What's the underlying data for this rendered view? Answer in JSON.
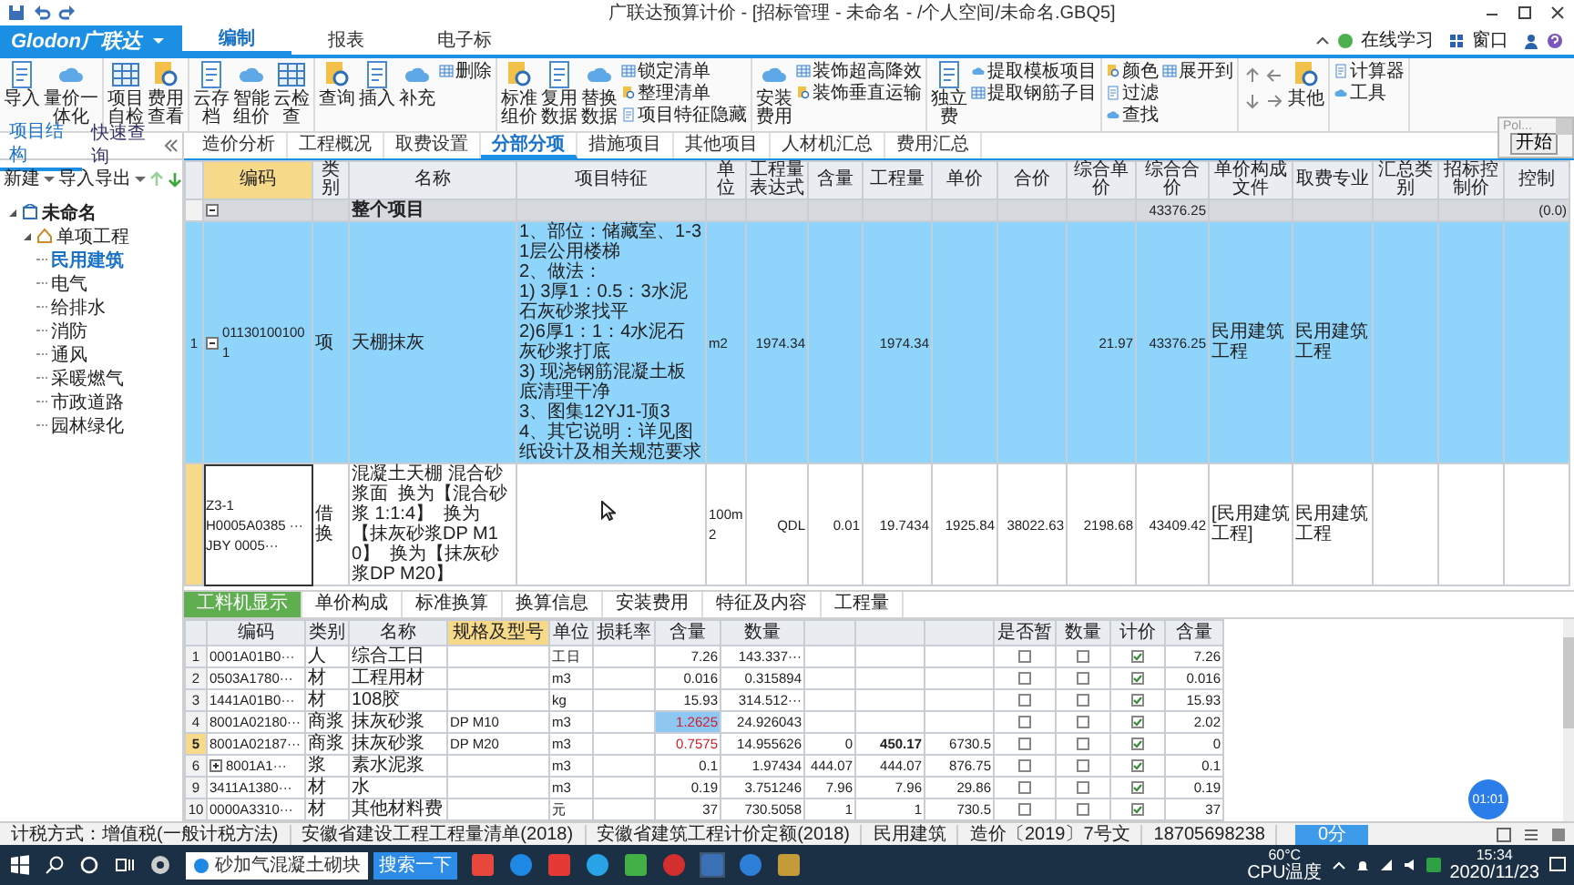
{
  "window": {
    "title": "广联达预算计价 - [招标管理 - 未命名 - /个人空间/未命名.GBQ5]"
  },
  "menu": {
    "logo": "Glodon广联达",
    "tabs": [
      {
        "label": "编制",
        "selected": true
      },
      {
        "label": "报表",
        "selected": false
      },
      {
        "label": "电子标",
        "selected": false
      }
    ],
    "right": [
      "在线学习",
      "窗口"
    ]
  },
  "ribbon": [
    {
      "items": [
        {
          "kind": "large",
          "label": "导入"
        },
        {
          "kind": "large",
          "label": "量价一体化"
        }
      ]
    },
    {
      "items": [
        {
          "kind": "large",
          "label": "项目自检"
        },
        {
          "kind": "large",
          "label": "费用查看"
        }
      ]
    },
    {
      "items": [
        {
          "kind": "large",
          "label": "云存档"
        },
        {
          "kind": "large",
          "label": "智能组价"
        },
        {
          "kind": "large",
          "label": "云检查"
        }
      ]
    },
    {
      "items": [
        {
          "kind": "large",
          "label": "查询"
        },
        {
          "kind": "large",
          "label": "插入"
        },
        {
          "kind": "large",
          "label": "补充"
        },
        {
          "kind": "small",
          "label": "删除"
        }
      ]
    },
    {
      "items": [
        {
          "kind": "large",
          "label": "标准组价"
        },
        {
          "kind": "large",
          "label": "复用数据"
        },
        {
          "kind": "large",
          "label": "替换数据"
        },
        {
          "kind": "small",
          "label": "锁定清单"
        },
        {
          "kind": "small",
          "label": "整理清单"
        },
        {
          "kind": "small",
          "label": "项目特征隐藏"
        }
      ]
    },
    {
      "items": [
        {
          "kind": "large",
          "label": "安装费用"
        },
        {
          "kind": "small",
          "label": "装饰超高降效"
        },
        {
          "kind": "small",
          "label": "装饰垂直运输"
        }
      ]
    },
    {
      "items": [
        {
          "kind": "large",
          "label": "独立费"
        },
        {
          "kind": "small",
          "label": "提取模板项目"
        },
        {
          "kind": "small",
          "label": "提取钢筋子目"
        }
      ]
    },
    {
      "items": [
        {
          "kind": "small",
          "label": "颜色"
        },
        {
          "kind": "small",
          "label": "过滤"
        },
        {
          "kind": "small",
          "label": "查找"
        },
        {
          "kind": "small",
          "label": "展开到"
        }
      ]
    },
    {
      "items": [
        {
          "kind": "arrows"
        },
        {
          "kind": "large",
          "label": "其他"
        }
      ]
    },
    {
      "items": [
        {
          "kind": "small",
          "label": "计算器"
        },
        {
          "kind": "small",
          "label": "工具"
        }
      ]
    }
  ],
  "left_panel": {
    "tabs": [
      {
        "label": "项目结构",
        "selected": true
      },
      {
        "label": "快速查询",
        "selected": false
      }
    ],
    "actions": [
      "新建",
      "导入导出"
    ],
    "tree": [
      {
        "label": "未命名",
        "expanded": true,
        "selected": false,
        "children": [
          {
            "label": "单项工程",
            "expanded": true,
            "selected": false,
            "children": [
              {
                "label": "民用建筑",
                "selected": true
              },
              {
                "label": "电气",
                "selected": false
              },
              {
                "label": "给排水",
                "selected": false
              },
              {
                "label": "消防",
                "selected": false
              },
              {
                "label": "通风",
                "selected": false
              },
              {
                "label": "采暖燃气",
                "selected": false
              },
              {
                "label": "市政道路",
                "selected": false
              },
              {
                "label": "园林绿化",
                "selected": false
              }
            ]
          }
        ]
      }
    ]
  },
  "tabs": [
    {
      "label": "造价分析",
      "selected": false
    },
    {
      "label": "工程概况",
      "selected": false
    },
    {
      "label": "取费设置",
      "selected": false
    },
    {
      "label": "分部分项",
      "selected": true
    },
    {
      "label": "措施项目",
      "selected": false
    },
    {
      "label": "其他项目",
      "selected": false
    },
    {
      "label": "人材机汇总",
      "selected": false
    },
    {
      "label": "费用汇总",
      "selected": false
    }
  ],
  "table": {
    "columns": [
      {
        "label": "编码",
        "current": true
      },
      {
        "label": "类别",
        "current": false
      },
      {
        "label": "名称",
        "current": false
      },
      {
        "label": "项目特征",
        "current": false
      },
      {
        "label": "单位",
        "current": false
      },
      {
        "label": "工程量表达式",
        "current": false
      },
      {
        "label": "含量",
        "current": false
      },
      {
        "label": "工程量",
        "current": false
      },
      {
        "label": "单价",
        "current": false
      },
      {
        "label": "合价",
        "current": false
      },
      {
        "label": "综合单价",
        "current": false
      },
      {
        "label": "综合合价",
        "current": false
      },
      {
        "label": "单价构成文件",
        "current": false
      },
      {
        "label": "取费专业",
        "current": false
      },
      {
        "label": "汇总类别",
        "current": false
      },
      {
        "label": "招标控制价",
        "current": false
      },
      {
        "label": "控制",
        "current": false
      }
    ],
    "rows": [
      {
        "kind": "section",
        "selected": false,
        "current": false,
        "expanded": true,
        "cells": [
          null,
          null,
          "整个项目",
          null,
          null,
          null,
          null,
          null,
          null,
          null,
          null,
          "43376.25",
          null,
          null,
          null,
          null,
          "(0.0)"
        ]
      },
      {
        "kind": "item",
        "no": "1",
        "selected": true,
        "current": false,
        "expanded": true,
        "cells": [
          "011301001001",
          "项",
          "天棚抹灰",
          "1、部位：储藏室、1-31层公用楼梯\n2、做法：\n1) 3厚1：0.5：3水泥石灰砂浆找平\n2)6厚1：1：4水泥石灰砂浆打底\n3) 现浇钢筋混凝土板底清理干净\n3、图集12YJ1-顶3\n4、其它说明：详见图纸设计及相关规范要求",
          "m2",
          "1974.34",
          null,
          "1974.34",
          null,
          null,
          "21.97",
          "43376.25",
          "民用建筑工程",
          "民用建筑工程",
          null,
          null,
          null
        ]
      },
      {
        "kind": "sub",
        "selected": false,
        "current": true,
        "cells": [
          "Z3-1\nH0005A0385 ···\nJBY 0005···",
          "借换",
          "混凝土天棚 混合砂浆面  换为【混合砂浆 1:1:4】  换为【抹灰砂浆DP M10】  换为【抹灰砂浆DP M20】",
          null,
          "100m2",
          "QDL",
          "0.01",
          "19.7434",
          "1925.84",
          "38022.63",
          "2198.68",
          "43409.42",
          "[民用建筑工程]",
          "民用建筑工程",
          null,
          null,
          null
        ]
      }
    ]
  },
  "detail": {
    "tabs": [
      {
        "label": "工料机显示",
        "selected": true
      },
      {
        "label": "单价构成",
        "selected": false
      },
      {
        "label": "标准换算",
        "selected": false
      },
      {
        "label": "换算信息",
        "selected": false
      },
      {
        "label": "安装费用",
        "selected": false
      },
      {
        "label": "特征及内容",
        "selected": false
      },
      {
        "label": "工程量",
        "selected": false
      }
    ],
    "columns": [
      {
        "label": "编码",
        "current": false
      },
      {
        "label": "类别",
        "current": false
      },
      {
        "label": "名称",
        "current": false
      },
      {
        "label": "规格及型号",
        "current": true
      },
      {
        "label": "单位",
        "current": false
      },
      {
        "label": "损耗率",
        "current": false
      },
      {
        "label": "含量",
        "current": false
      },
      {
        "label": "数量",
        "current": false
      },
      {
        "current": false
      },
      {
        "current": false
      },
      {
        "current": false
      },
      {
        "label": "是否暂",
        "current": false
      },
      {
        "label": "数量",
        "current": false
      },
      {
        "label": "计价",
        "current": false
      },
      {
        "label": "含量",
        "current": false
      }
    ],
    "rows": [
      {
        "no": "1",
        "selected": false,
        "has_children": false,
        "cells": [
          "0001A01B0···",
          "人",
          "综合工日",
          null,
          "工日",
          null,
          "7.26",
          "143.337···",
          null,
          null,
          null
        ],
        "flags": [
          false,
          false,
          true
        ],
        "modified": false,
        "original": "7.26"
      },
      {
        "no": "2",
        "selected": false,
        "has_children": false,
        "cells": [
          "0503A1780···",
          "材",
          "工程用材",
          null,
          "m3",
          null,
          "0.016",
          "0.315894",
          null,
          null,
          null
        ],
        "flags": [
          false,
          false,
          true
        ],
        "modified": false,
        "original": "0.016"
      },
      {
        "no": "3",
        "selected": false,
        "has_children": false,
        "cells": [
          "1441A01B0···",
          "材",
          "108胶",
          null,
          "kg",
          null,
          "15.93",
          "314.512···",
          null,
          null,
          null
        ],
        "flags": [
          false,
          false,
          true
        ],
        "modified": false,
        "original": "15.93"
      },
      {
        "no": "4",
        "selected": false,
        "has_children": false,
        "cells": [
          "8001A02180···",
          "商浆",
          "抹灰砂浆",
          "DP M10",
          "m3",
          null,
          "1.2625",
          "24.926043",
          null,
          null,
          null
        ],
        "flags": [
          false,
          false,
          true
        ],
        "modified": true,
        "original": "2.02"
      },
      {
        "no": "5",
        "selected": true,
        "has_children": false,
        "cells": [
          "8001A02187···",
          "商浆",
          "抹灰砂浆",
          "DP M20",
          "m3",
          null,
          "0.7575",
          "14.955626",
          "0",
          "450.17",
          "6730.5"
        ],
        "flags": [
          false,
          false,
          true
        ],
        "modified": true,
        "original": "0"
      },
      {
        "no": "6",
        "selected": false,
        "has_children": true,
        "cells": [
          "8001A1···",
          "浆",
          "素水泥浆",
          null,
          "m3",
          null,
          "0.1",
          "1.97434",
          "444.07",
          "444.07",
          "876.75"
        ],
        "flags": [
          false,
          false,
          true
        ],
        "modified": false,
        "original": "0.1"
      },
      {
        "no": "9",
        "selected": false,
        "has_children": false,
        "cells": [
          "3411A1380···",
          "材",
          "水",
          null,
          "m3",
          null,
          "0.19",
          "3.751246",
          "7.96",
          "7.96",
          "29.86"
        ],
        "flags": [
          false,
          false,
          true
        ],
        "modified": false,
        "original": "0.19"
      },
      {
        "no": "10",
        "selected": false,
        "has_children": false,
        "cells": [
          "0000A3310···",
          "材",
          "其他材料费",
          null,
          "元",
          null,
          "37",
          "730.5058",
          "1",
          "1",
          "730.5"
        ],
        "flags": [
          false,
          false,
          true
        ],
        "modified": false,
        "original": "37"
      }
    ]
  },
  "popup": {
    "title": "Pol...",
    "button": "开始"
  },
  "timer": "01:01",
  "status_bar": {
    "items": [
      "计税方式：增值税(一般计税方法)",
      "安徽省建设工程工程量清单(2018)",
      "安徽省建筑工程计价定额(2018)",
      "民用建筑",
      "造价〔2019〕7号文",
      "18705698238"
    ],
    "button": "0分"
  },
  "taskbar": {
    "search": "砂加气混凝土砌块",
    "search_button": "搜索一下",
    "temperature": "60°C",
    "temperature_label": "CPU温度",
    "time": "15:34",
    "date": "2020/11/23"
  }
}
